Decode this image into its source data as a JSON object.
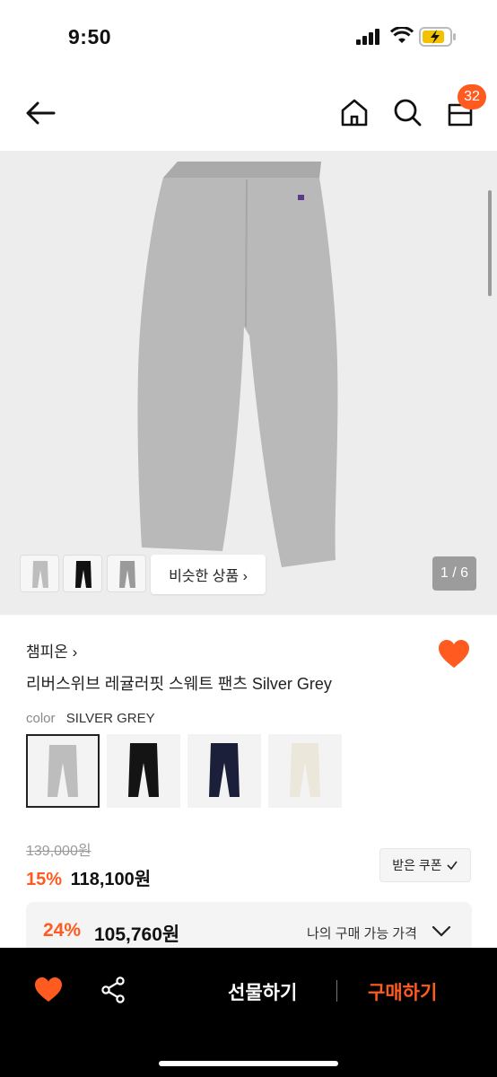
{
  "status_bar": {
    "time": "9:50"
  },
  "nav": {
    "cart_count": "32"
  },
  "gallery": {
    "similar_label": "비슷한 상품 ›",
    "pager": "1 / 6"
  },
  "product": {
    "brand": "챔피온 ›",
    "title": "리버스위브 레귤러핏 스웨트 팬츠 Silver Grey",
    "color_label": "color",
    "color_value": "SILVER GREY",
    "swatches": [
      "silver-grey",
      "black",
      "navy",
      "cream"
    ]
  },
  "price": {
    "original": "139,000원",
    "discount_pct": "15%",
    "discount_price": "118,100원",
    "coupon_label": "받은 쿠폰",
    "best_pct": "24%",
    "best_price": "105,760원",
    "my_price_label": "나의 구매 가능 가격"
  },
  "bottom_bar": {
    "gift_label": "선물하기",
    "buy_label": "구매하기"
  },
  "colors": {
    "accent": "#ff5a1f"
  }
}
